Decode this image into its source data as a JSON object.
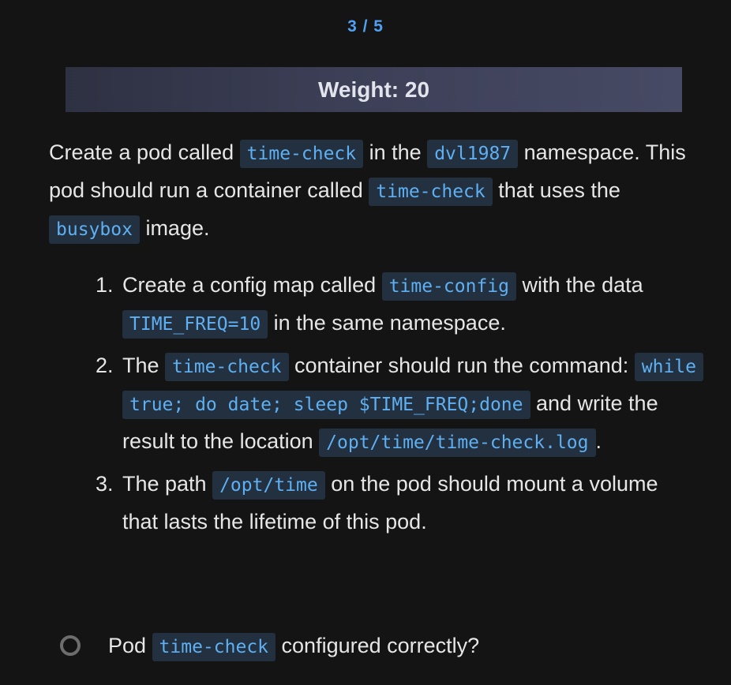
{
  "progress": {
    "text": "3 / 5"
  },
  "header": {
    "weight_label": "Weight: 20"
  },
  "intro": {
    "t1": "Create a pod called ",
    "c1": "time-check",
    "t2": " in the ",
    "c2": "dvl1987",
    "t3": " namespace. This pod should run a container called ",
    "c3": "time-check",
    "t4": " that uses the ",
    "c4": "busybox",
    "t5": " image."
  },
  "steps": [
    {
      "num": "1.",
      "t1": "Create a config map called ",
      "c1": "time-config",
      "t2": " with the data ",
      "c2": "TIME_FREQ=10",
      "t3": " in the same namespace."
    },
    {
      "num": "2.",
      "t1": "The ",
      "c1": "time-check",
      "t2": " container should run the command: ",
      "c2": "while true; do date; sleep $TIME_FREQ;done",
      "t3": " and write the result to the location ",
      "c3": "/opt/time/time-check.log",
      "t4": "."
    },
    {
      "num": "3.",
      "t1": "The path ",
      "c1": "/opt/time",
      "t2": " on the pod should mount a volume that lasts the lifetime of this pod."
    }
  ],
  "checks": [
    {
      "t1": "Pod ",
      "c1": "time-check",
      "t2": " configured correctly?"
    }
  ]
}
